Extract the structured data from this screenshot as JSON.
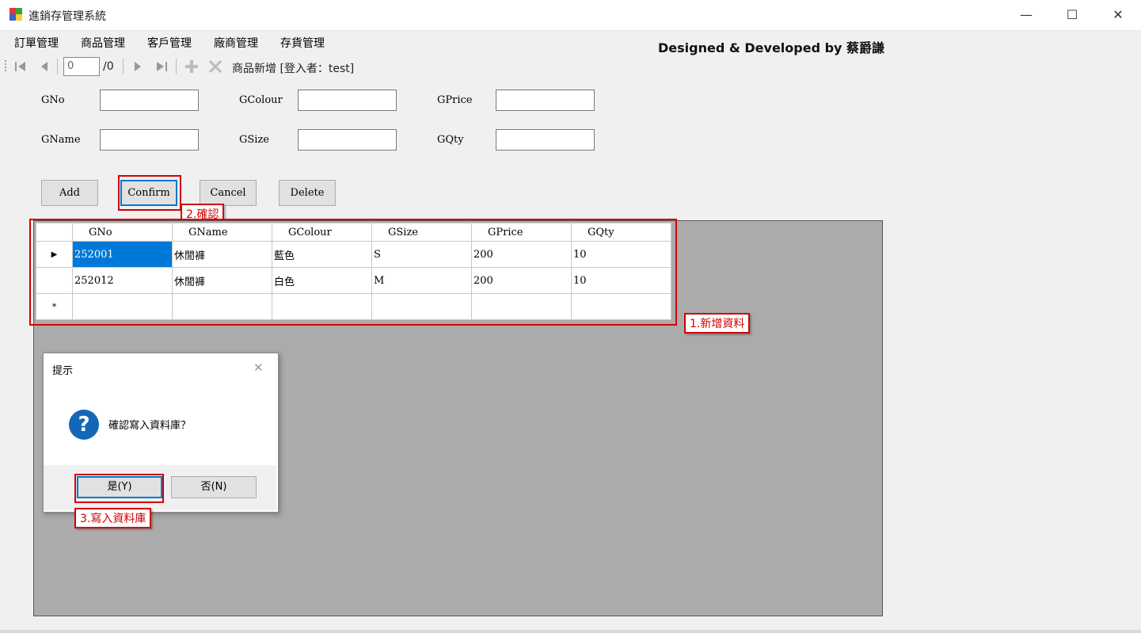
{
  "window": {
    "title": "進銷存管理系統",
    "minimize": "—",
    "maximize": "☐",
    "close": "✕"
  },
  "menu": [
    {
      "label": "訂單管理"
    },
    {
      "label": "商品管理"
    },
    {
      "label": "客戶管理"
    },
    {
      "label": "廠商管理"
    },
    {
      "label": "存貨管理"
    }
  ],
  "credit": "Designed & Developed by 蔡爵謙",
  "toolbar": {
    "position": "0",
    "count": "/0",
    "status": "商品新增  [登入者：test]"
  },
  "form": {
    "labels": {
      "gno": "GNo",
      "gname": "GName",
      "gcolour": "GColour",
      "gsize": "GSize",
      "gprice": "GPrice",
      "gqty": "GQty"
    }
  },
  "buttons": {
    "add": "Add",
    "confirm": "Confirm",
    "cancel": "Cancel",
    "delete": "Delete"
  },
  "grid": {
    "columns": [
      "GNo",
      "GName",
      "GColour",
      "GSize",
      "GPrice",
      "GQty"
    ],
    "rows": [
      [
        "252001",
        "休閒褲",
        "藍色",
        "S",
        "200",
        "10"
      ],
      [
        "252012",
        "休閒褲",
        "白色",
        "M",
        "200",
        "10"
      ]
    ],
    "current_row_marker": "▶",
    "new_row_marker": "*"
  },
  "dialog": {
    "title": "提示",
    "message": "確認寫入資料庫？",
    "yes": "是(Y)",
    "no": "否(N)",
    "close": "✕",
    "icon": "?"
  },
  "annotations": {
    "step1": "1.新增資料",
    "step2": "2.確認",
    "step3": "3.寫入資料庫"
  },
  "colors": {
    "annotation": "#d40000",
    "selection": "#0078d7",
    "grid_background": "#ababab"
  }
}
